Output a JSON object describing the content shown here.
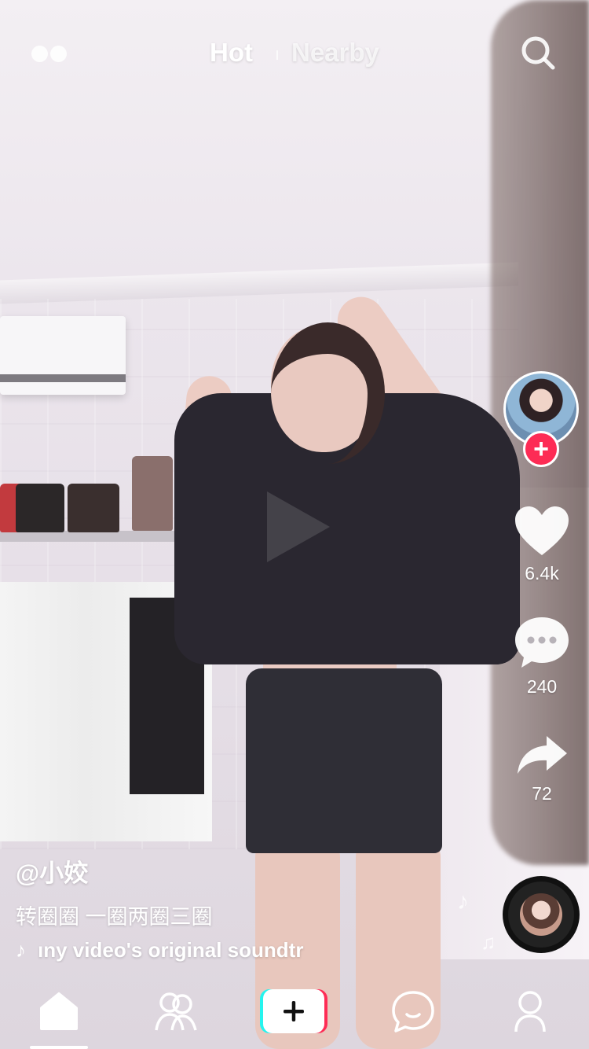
{
  "top_bar": {
    "tabs": [
      {
        "label": "Hot",
        "active": true
      },
      {
        "label": "Nearby",
        "active": false
      }
    ],
    "menu_icon": "two-dots-icon",
    "search_icon": "search-icon"
  },
  "sidebar": {
    "avatar_icon": "creator-avatar",
    "follow_icon": "plus-icon",
    "likes": "6.4k",
    "comments": "240",
    "shares": "72",
    "music_disc_icon": "music-disc"
  },
  "caption": {
    "username": "@小姣",
    "description": "转圈圈 一圈两圈三圈",
    "sound_icon": "tiktok-note-icon",
    "sound": "ıny video's original soundtr"
  },
  "tab_bar": {
    "items": [
      "home-icon",
      "friends-icon",
      "create-icon",
      "messages-icon",
      "me-icon"
    ],
    "active": "home-icon"
  },
  "colors": {
    "accent": "#fd2c55",
    "create_cyan": "#25f4ee",
    "create_red": "#fe2c55"
  }
}
